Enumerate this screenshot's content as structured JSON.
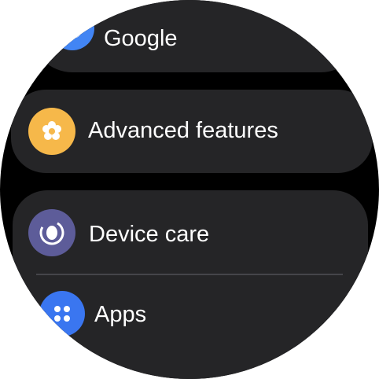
{
  "menu": {
    "items": [
      {
        "label": "Google",
        "icon": "google-icon",
        "color": "#4285f4"
      },
      {
        "label": "Advanced features",
        "icon": "advanced-features-icon",
        "color": "#f6b84a"
      },
      {
        "label": "Device care",
        "icon": "device-care-icon",
        "color": "#5d5c99"
      },
      {
        "label": "Apps",
        "icon": "apps-icon",
        "color": "#3a76f0"
      }
    ]
  },
  "colors": {
    "card": "#252527",
    "background": "#000000",
    "divider": "#45454a"
  }
}
